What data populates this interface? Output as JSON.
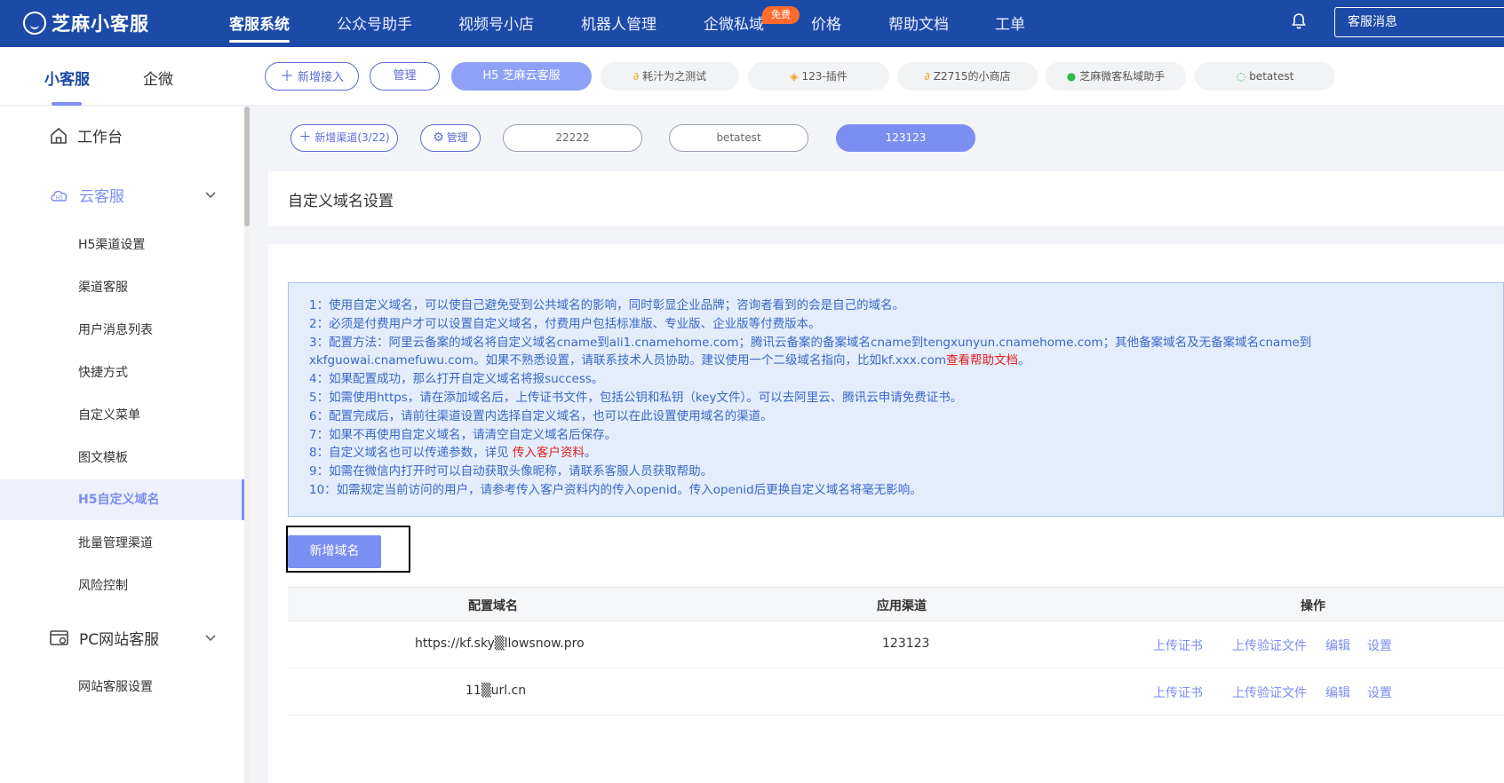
{
  "app": {
    "logo_text": "芝麻小客服"
  },
  "topnav": {
    "items": [
      "客服系统",
      "公众号助手",
      "视频号小店",
      "机器人管理",
      "企微私域",
      "价格",
      "帮助文档",
      "工单"
    ],
    "free_badge": "免费",
    "right_button": "客服消息"
  },
  "subbar": {
    "tabs": [
      "小客服",
      "企微"
    ],
    "buttons": {
      "add": "新增接入",
      "manage": "管理"
    },
    "apps": [
      "H5 芝麻云客服",
      "耗汁为之测试",
      "123-插件",
      "Z2715的小商店",
      "芝麻微客私域助手",
      "betatest"
    ]
  },
  "sidebar": {
    "workbench": "工作台",
    "cloud_group": "云客服",
    "cloud_items": [
      "H5渠道设置",
      "渠道客服",
      "用户消息列表",
      "快捷方式",
      "自定义菜单",
      "图文模板",
      "H5自定义域名",
      "批量管理渠道",
      "风险控制"
    ],
    "pc_group": "PC网站客服",
    "pc_items": [
      "网站客服设置"
    ]
  },
  "channels": {
    "add": "新增渠道(3/22)",
    "manage": "管理",
    "items": [
      "22222",
      "betatest",
      "123123"
    ]
  },
  "page": {
    "title": "自定义域名设置",
    "notice": {
      "l1": "1：使用自定义域名，可以使自己避免受到公共域名的影响，同时彰显企业品牌；咨询者看到的会是自己的域名。",
      "l2": "2：必须是付费用户才可以设置自定义域名，付费用户包括标准版、专业版、企业版等付费版本。",
      "l3": "3：配置方法：阿里云备案的域名将自定义域名cname到ali1.cnamehome.com；腾讯云备案的备案域名cname到tengxunyun.cnamehome.com；其他备案域名及无备案域名cname到",
      "l3b": "xkfguowai.cnamefuwu.com。如果不熟悉设置，请联系技术人员协助。建议使用一个二级域名指向，比如kf.xxx.com",
      "l3b_link": "查看帮助文档",
      "l3b_end": "。",
      "l4": "4：如果配置成功，那么打开自定义域名将报success。",
      "l5": "5：如需使用https，请在添加域名后，上传证书文件，包括公钥和私钥（key文件）。可以去阿里云、腾讯云申请免费证书。",
      "l6": "6：配置完成后，请前往渠道设置内选择自定义域名，也可以在此设置使用域名的渠道。",
      "l7": "7：如果不再使用自定义域名，请清空自定义域名后保存。",
      "l8": "8：自定义域名也可以传递参数，详见 ",
      "l8_link": "传入客户资料",
      "l8_end": "。",
      "l9": "9：如需在微信内打开时可以自动获取头像昵称，请联系客服人员获取帮助。",
      "l10": "10：如需规定当前访问的用户，请参考传入客户资料内的传入openid。传入openid后更换自定义域名将毫无影响。"
    },
    "add_domain_button": "新增域名",
    "table": {
      "headers": [
        "配置域名",
        "应用渠道",
        "操作"
      ],
      "rows": [
        {
          "domain": "https://kf.sky▒llowsnow.pro",
          "channel": "123123",
          "ops": [
            "上传证书",
            "上传验证文件",
            "编辑",
            "设置"
          ]
        },
        {
          "domain": "11▒url.cn",
          "channel": "",
          "ops": [
            "上传证书",
            "上传验证文件",
            "编辑",
            "设置"
          ]
        }
      ]
    }
  },
  "colors": {
    "nav": "#1c4aa7",
    "accent": "#7b8ef2",
    "link_red": "#e02020",
    "notice_bg": "#e4edfb"
  }
}
